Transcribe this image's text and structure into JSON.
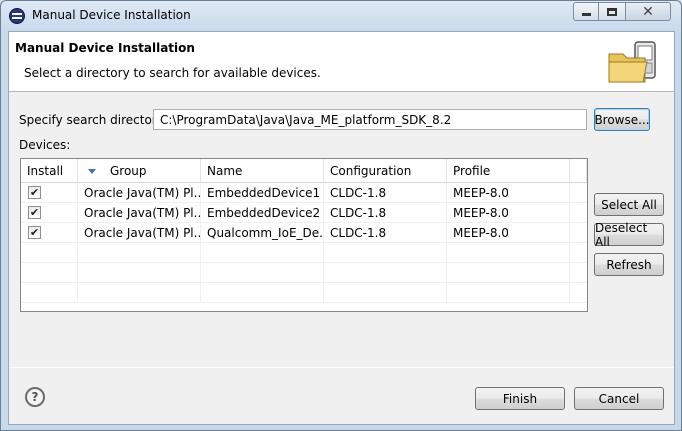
{
  "window": {
    "title": "Manual Device Installation",
    "minimize_icon": "minimize-icon",
    "maximize_icon": "maximize-icon",
    "close_icon": "close-icon",
    "close_glyph": "✕"
  },
  "banner": {
    "title": "Manual Device Installation",
    "description": "Select a directory to search for available devices.",
    "icon": "folder-device-icon"
  },
  "search": {
    "label": "Specify search directory:",
    "value": "C:\\ProgramData\\Java\\Java_ME_platform_SDK_8.2",
    "browse_label": "Browse..."
  },
  "devices": {
    "label": "Devices:",
    "columns": [
      "Install",
      "Group",
      "Name",
      "Configuration",
      "Profile"
    ],
    "sort_column": "Group",
    "rows": [
      {
        "install": true,
        "group": "Oracle Java(TM) Pl...",
        "name": "EmbeddedDevice1",
        "configuration": "CLDC-1.8",
        "profile": "MEEP-8.0"
      },
      {
        "install": true,
        "group": "Oracle Java(TM) Pl...",
        "name": "EmbeddedDevice2",
        "configuration": "CLDC-1.8",
        "profile": "MEEP-8.0"
      },
      {
        "install": true,
        "group": "Oracle Java(TM) Pl...",
        "name": "Qualcomm_IoE_De...",
        "configuration": "CLDC-1.8",
        "profile": "MEEP-8.0"
      }
    ]
  },
  "side_buttons": {
    "select_all": "Select All",
    "deselect_all": "Deselect All",
    "refresh": "Refresh"
  },
  "footer": {
    "help_glyph": "?",
    "finish_label": "Finish",
    "cancel_label": "Cancel"
  },
  "colors": {
    "window_frame": "#c9d9ec",
    "dialog_bg": "#f0f0f0",
    "sort_arrow": "#4a73a8",
    "focus_border": "#3c7fb1"
  }
}
